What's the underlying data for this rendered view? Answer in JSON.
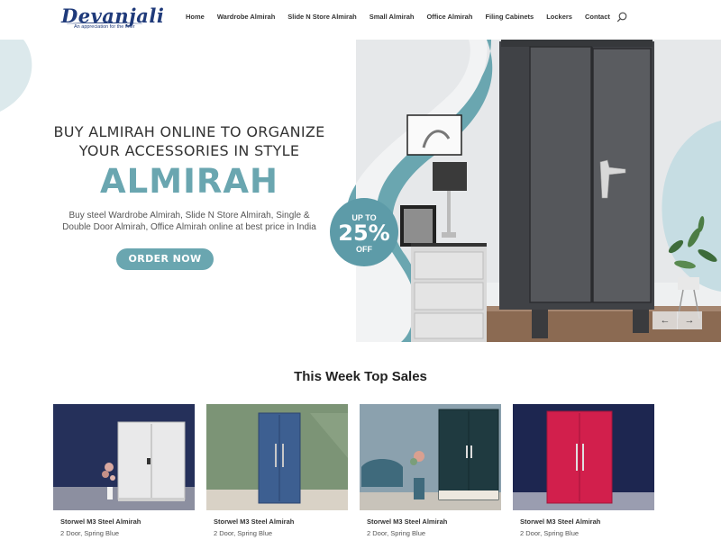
{
  "brand": {
    "name": "Devanjali",
    "tagline": "An appreciation for the finer"
  },
  "nav": {
    "items": [
      "Home",
      "Wardrobe Almirah",
      "Slide N Store Almirah",
      "Small Almirah",
      "Office Almirah",
      "Filing Cabinets",
      "Lockers",
      "Contact"
    ]
  },
  "hero": {
    "title_line1": "BUY ALMIRAH ONLINE TO ORGANIZE",
    "title_line2": "YOUR ACCESSORIES IN STYLE",
    "big_word": "ALMIRAH",
    "desc_line1": "Buy steel Wardrobe Almirah, Slide N Store Almirah, Single &",
    "desc_line2": "Double Door Almirah, Office Almirah online at best price in India",
    "cta_label": "ORDER NOW",
    "badge": {
      "top": "UP TO",
      "value": "25%",
      "bottom": "OFF"
    },
    "prev_arrow": "←",
    "next_arrow": "→"
  },
  "sales": {
    "title": "This Week Top Sales",
    "products": [
      {
        "name": "Storwel M3 Steel Almirah",
        "desc": "2 Door, Spring Blue"
      },
      {
        "name": "Storwel M3 Steel Almirah",
        "desc": "2 Door, Spring Blue"
      },
      {
        "name": "Storwel M3 Steel Almirah",
        "desc": "2 Door, Spring Blue"
      },
      {
        "name": "Storwel M3 Steel Almirah",
        "desc": "2 Door, Spring Blue"
      }
    ]
  },
  "colors": {
    "accent": "#6aa6b0",
    "brand": "#1f3a7a",
    "cabinet_dark": "#55575b"
  }
}
